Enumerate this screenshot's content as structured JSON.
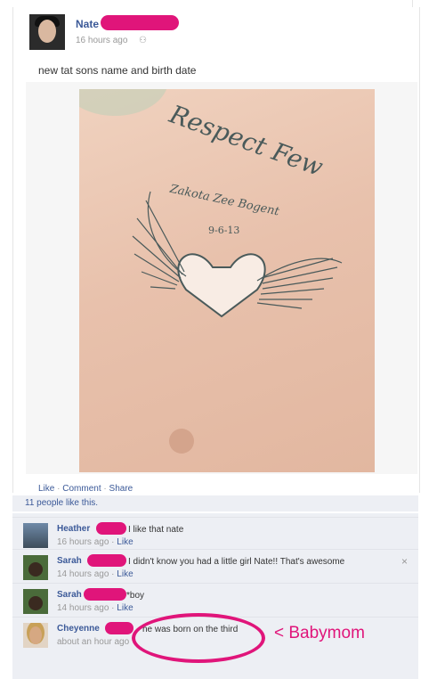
{
  "post": {
    "author": "Nate",
    "time": "16 hours ago",
    "friends_icon": "friends-icon",
    "status": "new tat sons name and birth date",
    "tattoo_text": {
      "line1": "Respect Few",
      "line2": "Zakota Zee Bogent",
      "line3": "9-6-13"
    },
    "actions": {
      "like": "Like",
      "comment": "Comment",
      "share": "Share",
      "separator": "·"
    },
    "likes_summary": "11 people like this."
  },
  "comments": [
    {
      "name": "Heather",
      "text": "I like that nate",
      "time": "16 hours ago",
      "like": "Like"
    },
    {
      "name": "Sarah",
      "text": "I didn't know you had a little girl Nate!! That's awesome",
      "time": "14 hours ago",
      "like": "Like"
    },
    {
      "name": "Sarah",
      "text": "*boy",
      "time": "14 hours ago",
      "like": "Like"
    },
    {
      "name": "Cheyenne",
      "text": "he was born on the third",
      "time": "about an hour ago"
    }
  ],
  "close_symbol": "×",
  "annotation": "< Babymom",
  "colors": {
    "link": "#3b5998",
    "redaction": "#e0157a",
    "comment_bg": "#edeff4"
  }
}
